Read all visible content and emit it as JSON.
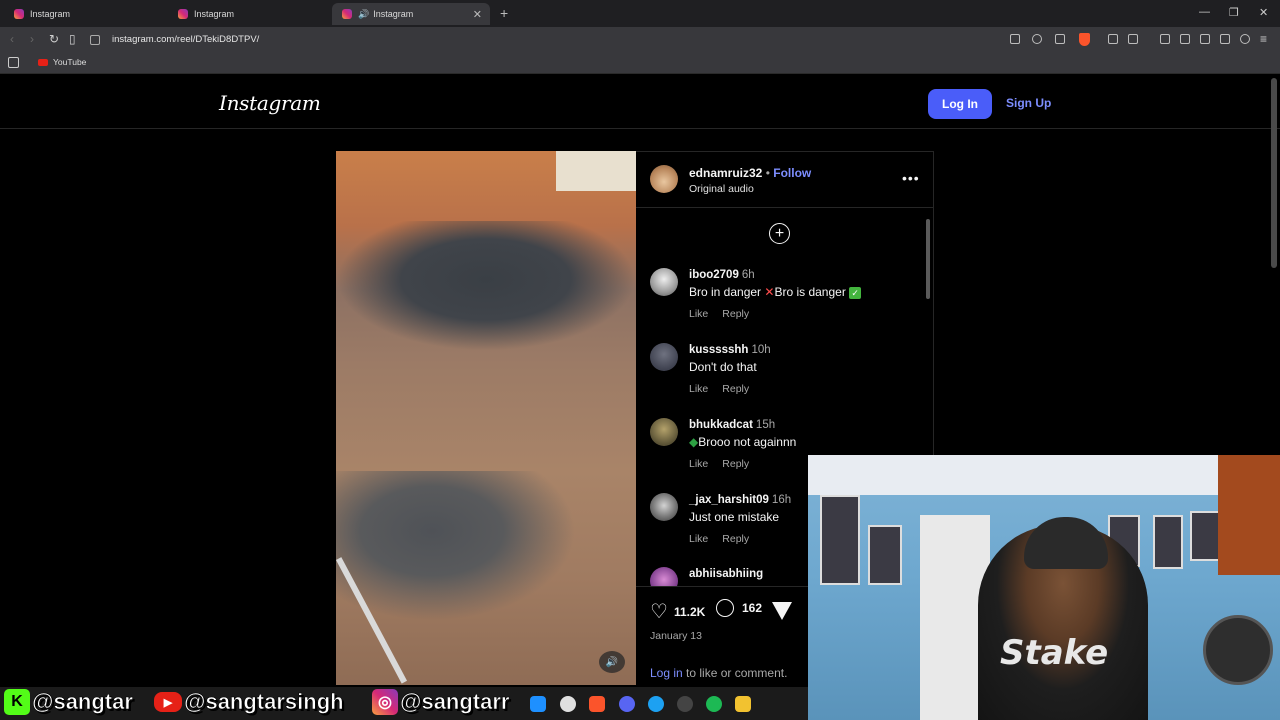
{
  "browser": {
    "tabs": [
      {
        "title": "Instagram",
        "active": false
      },
      {
        "title": "Instagram",
        "active": false
      },
      {
        "title": "Instagram",
        "active": true
      }
    ],
    "url": "instagram.com/reel/DTekiD8DTPV/",
    "bookmarks": [
      {
        "label": "YouTube"
      }
    ]
  },
  "header": {
    "logo": "Instagram",
    "login_label": "Log In",
    "signup_label": "Sign Up"
  },
  "post": {
    "author": "ednamruiz32",
    "separator": "•",
    "follow_label": "Follow",
    "audio": "Original audio",
    "likes": "11.2K",
    "comments_count": "162",
    "date": "January 13",
    "login_prompt_link": "Log in",
    "login_prompt_rest": " to like or comment."
  },
  "comments": [
    {
      "user": "iboo2709",
      "time": "6h",
      "text_a": "Bro in danger ",
      "text_b": "Bro is danger ",
      "like": "Like",
      "reply": "Reply"
    },
    {
      "user": "kussssshh",
      "time": "10h",
      "text": "Don't do that",
      "like": "Like",
      "reply": "Reply"
    },
    {
      "user": "bhukkadcat",
      "time": "15h",
      "text": "Brooo not againnn",
      "like": "Like",
      "reply": "Reply"
    },
    {
      "user": "_jax_harshit09",
      "time": "16h",
      "text": "Just one mistake",
      "like": "Like",
      "reply": "Reply"
    },
    {
      "user": "abhiisabhiing",
      "time": "",
      "text": "",
      "like": "",
      "reply": ""
    }
  ],
  "overlay": {
    "handles": [
      "@sangtar",
      "@sangtarsingh",
      "@sangtarr"
    ],
    "cam_logo": "Stake"
  },
  "colors": {
    "accent": "#4a5df9",
    "link": "#7d8eff",
    "background": "#000000",
    "muted": "#a8a8a8"
  }
}
